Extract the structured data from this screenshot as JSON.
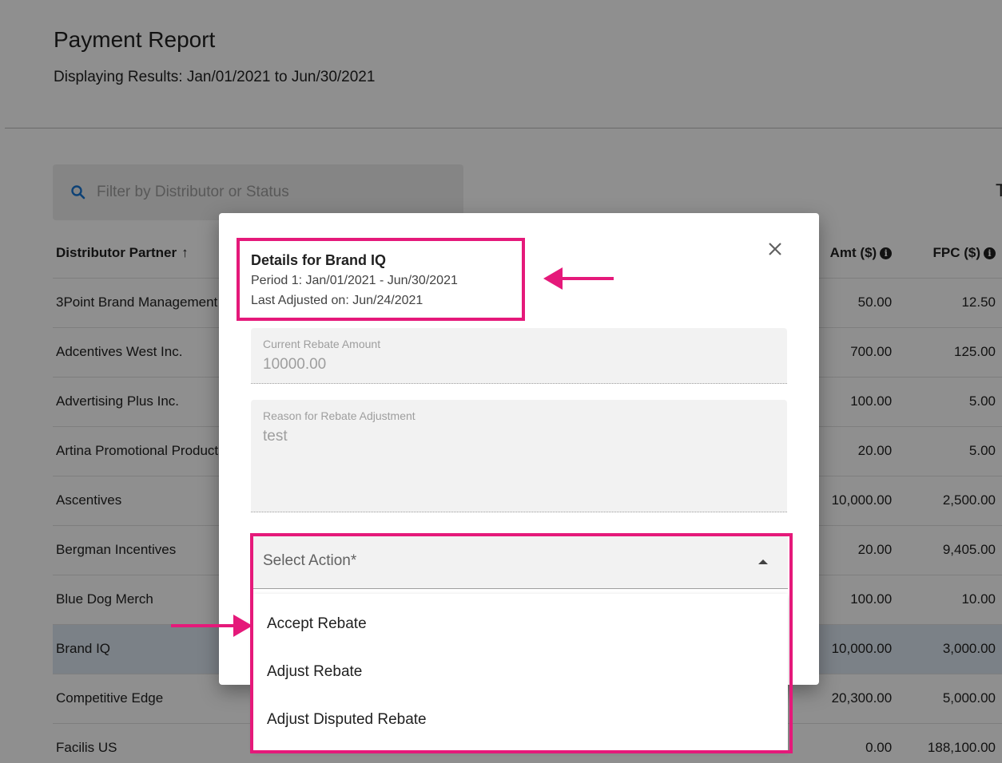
{
  "header": {
    "title": "Payment Report",
    "subtitle": "Displaying Results: Jan/01/2021 to Jun/30/2021"
  },
  "filter": {
    "placeholder": "Filter by Distributor or Status",
    "icon": "search-icon"
  },
  "edge_text": "T",
  "table": {
    "columns": {
      "distributor": "Distributor Partner",
      "amt": "Amt ($)",
      "fpc": "FPC ($)"
    },
    "sort_icon": "arrow-up-icon",
    "rows": [
      {
        "distributor": "3Point Brand Management",
        "col_a": "",
        "col_b": "",
        "amt": "50.00",
        "fpc": "12.50"
      },
      {
        "distributor": "Adcentives West Inc.",
        "col_a": "",
        "col_b": "",
        "amt": "700.00",
        "fpc": "125.00"
      },
      {
        "distributor": "Advertising Plus Inc.",
        "col_a": "",
        "col_b": "",
        "amt": "100.00",
        "fpc": "5.00"
      },
      {
        "distributor": "Artina Promotional Products",
        "col_a": "",
        "col_b": "",
        "amt": "20.00",
        "fpc": "5.00"
      },
      {
        "distributor": "Ascentives",
        "col_a": "",
        "col_b": "",
        "amt": "10,000.00",
        "fpc": "2,500.00"
      },
      {
        "distributor": "Bergman Incentives",
        "col_a": "",
        "col_b": "",
        "amt": "20.00",
        "fpc": "9,405.00"
      },
      {
        "distributor": "Blue Dog Merch",
        "col_a": "",
        "col_b": "",
        "amt": "100.00",
        "fpc": "10.00"
      },
      {
        "distributor": "Brand IQ",
        "col_a": "",
        "col_b": "",
        "amt": "10,000.00",
        "fpc": "3,000.00"
      },
      {
        "distributor": "Competitive Edge",
        "col_a": "",
        "col_b": "",
        "amt": "20,300.00",
        "fpc": "5,000.00"
      },
      {
        "distributor": "Facilis US",
        "col_a": "",
        "col_b": "",
        "amt": "0.00",
        "fpc": "188,100.00"
      }
    ]
  },
  "modal": {
    "title": "Details for Brand IQ",
    "period": "Period 1: Jan/01/2021 - Jun/30/2021",
    "last_adjusted": "Last Adjusted on: Jun/24/2021",
    "current_rebate_label": "Current Rebate Amount",
    "current_rebate_value": "10000.00",
    "reason_label": "Reason for Rebate Adjustment",
    "reason_value": "test",
    "select_label": "Select Action*",
    "options": [
      "Accept Rebate",
      "Adjust Rebate",
      "Adjust Disputed Rebate"
    ]
  },
  "colors": {
    "accent": "#e5197a",
    "overlay": "#000000",
    "selected_row": "#dce6f0"
  }
}
